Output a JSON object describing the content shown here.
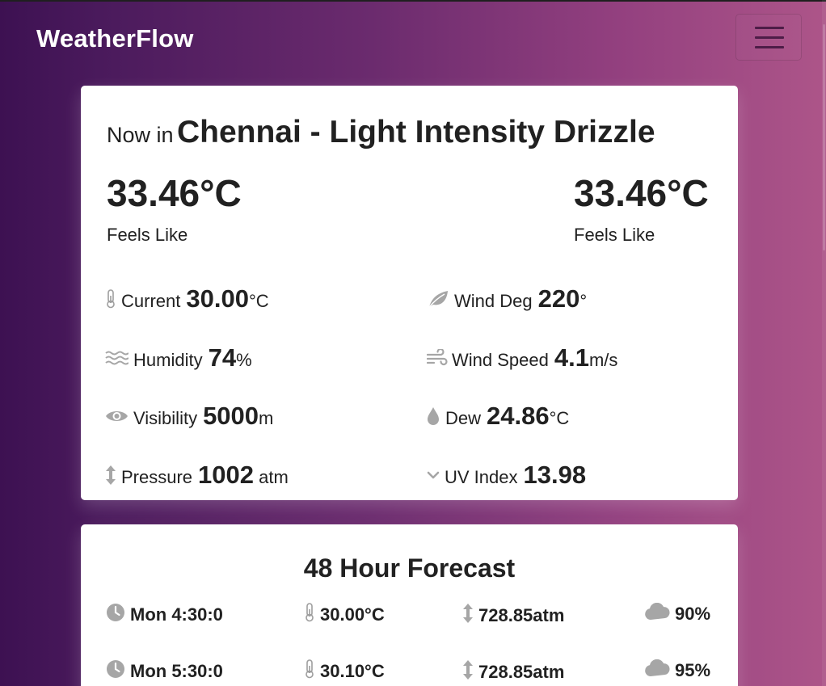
{
  "app": {
    "brand": "WeatherFlow"
  },
  "nav": {
    "menu_icon": "hamburger-menu-icon"
  },
  "current": {
    "now_prefix": "Now in",
    "title": "Chennai - Light Intensity Drizzle",
    "left_temp": "33.46°C",
    "left_label": "Feels Like",
    "right_temp": "33.46°C",
    "right_label": "Feels Like",
    "stats": {
      "current": {
        "label": "Current",
        "value": "30.00",
        "unit": "°C",
        "icon": "thermometer-icon"
      },
      "wind_deg": {
        "label": "Wind Deg",
        "value": "220",
        "unit": "°",
        "icon": "leaf-icon"
      },
      "humidity": {
        "label": "Humidity",
        "value": "74",
        "unit": "%",
        "icon": "water-waves-icon"
      },
      "wind_speed": {
        "label": "Wind Speed",
        "value": "4.1",
        "unit": "m/s",
        "icon": "wind-icon"
      },
      "visibility": {
        "label": "Visibility",
        "value": "5000",
        "unit": "m",
        "icon": "eye-icon"
      },
      "dew": {
        "label": "Dew",
        "value": "24.86",
        "unit": "°C",
        "icon": "droplet-icon"
      },
      "pressure": {
        "label": "Pressure",
        "value": "1002",
        "unit": " atm",
        "icon": "vertical-arrows-icon"
      },
      "uv_index": {
        "label": "UV Index",
        "value": "13.98",
        "unit": "",
        "icon": "chevron-down-icon"
      }
    }
  },
  "forecast": {
    "title": "48 Hour Forecast",
    "rows": [
      {
        "time": "Mon 4:30:0",
        "temp": "30.00°C",
        "pressure": "728.85atm",
        "clouds": "90%"
      },
      {
        "time": "Mon 5:30:0",
        "temp": "30.10°C",
        "pressure": "728.85atm",
        "clouds": "95%"
      }
    ]
  },
  "colors": {
    "gradient_start": "#3d1152",
    "gradient_end": "#ad5589",
    "card_bg": "#ffffff",
    "icon_gray": "#9e9e9e",
    "text_dark": "#212121",
    "brand_text": "#ffffff"
  }
}
